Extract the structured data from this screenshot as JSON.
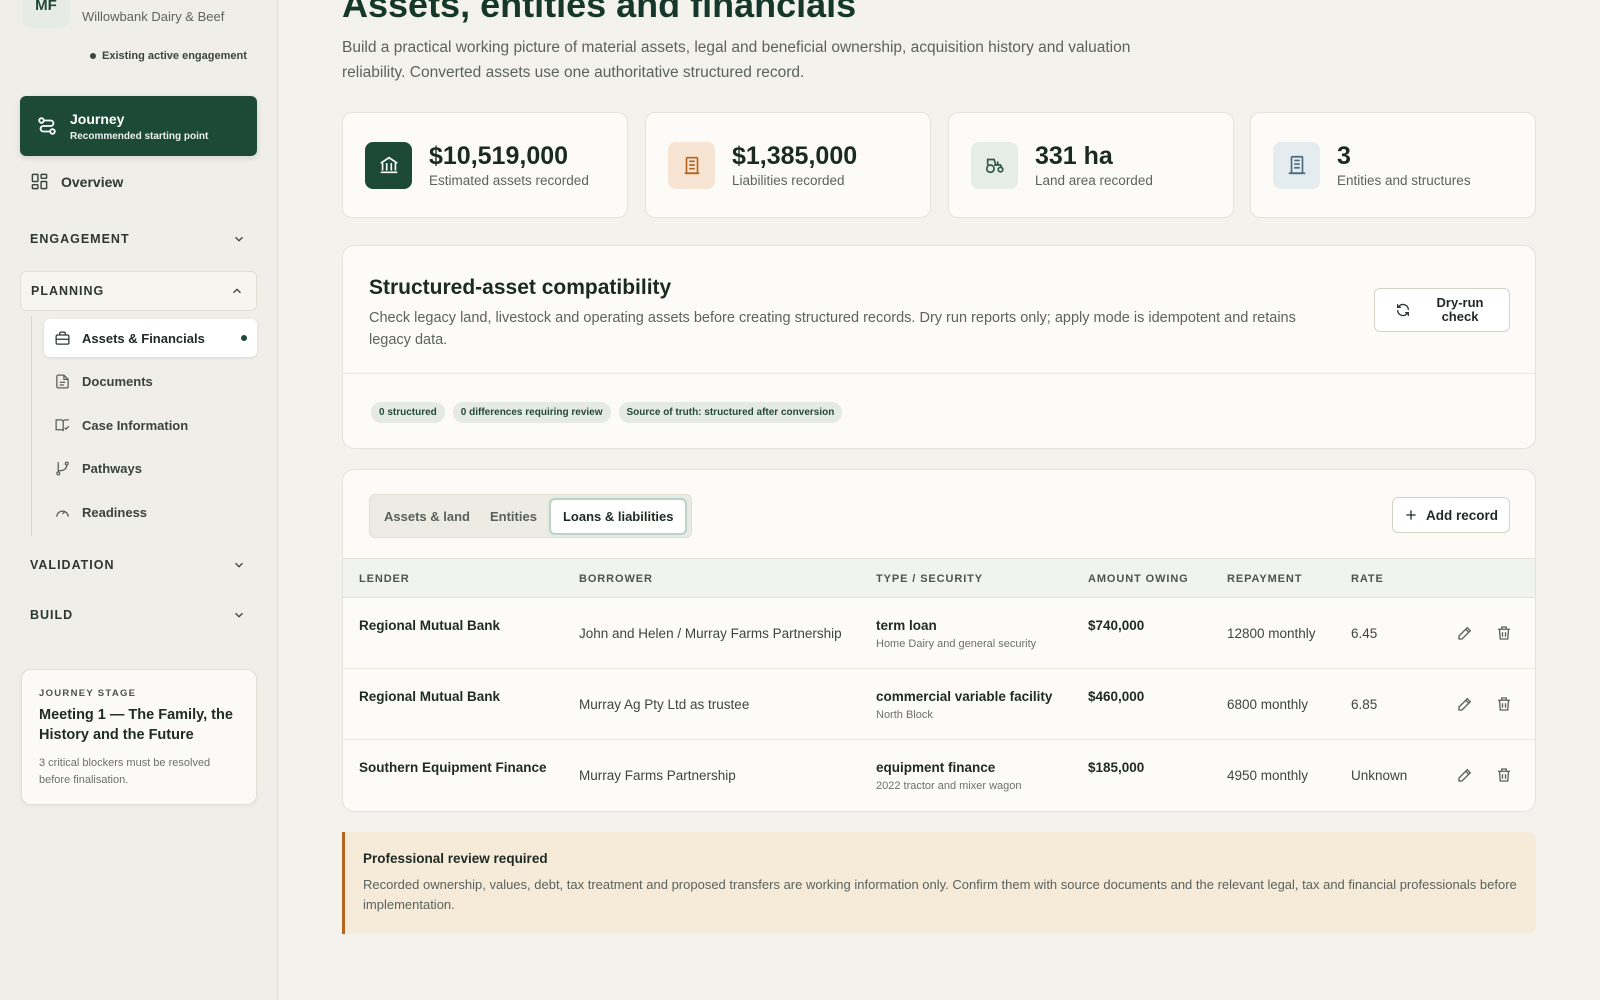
{
  "sidebar": {
    "client_initials": "MF",
    "client_subtitle": "Willowbank Dairy & Beef",
    "engagement_status": "Existing active engagement",
    "journey": {
      "title": "Journey",
      "subtitle": "Recommended starting point"
    },
    "overview": "Overview",
    "sections": {
      "engagement": "ENGAGEMENT",
      "planning": "PLANNING",
      "validation": "VALIDATION",
      "build": "BUILD"
    },
    "planning_items": [
      "Assets & Financials",
      "Documents",
      "Case Information",
      "Pathways",
      "Readiness"
    ],
    "active_item": "Assets & Financials",
    "stage": {
      "kicker": "JOURNEY STAGE",
      "title": "Meeting 1 — The Family, the History and the Future",
      "note": "3 critical blockers must be resolved before finalisation."
    }
  },
  "main": {
    "title": "Assets, entities and financials",
    "description": "Build a practical working picture of material assets, legal and beneficial ownership, acquisition history and valuation reliability. Converted assets use one authoritative structured record.",
    "stats": [
      {
        "icon": "bank-icon",
        "value": "$10,519,000",
        "label": "Estimated assets recorded",
        "bg": "#1d4a37",
        "fg": "#ffffff"
      },
      {
        "icon": "coins-icon",
        "value": "$1,385,000",
        "label": "Liabilities recorded",
        "bg": "#f7e4d2",
        "fg": "#b5651d"
      },
      {
        "icon": "tractor-icon",
        "value": "331 ha",
        "label": "Land area recorded",
        "bg": "#e6ece6",
        "fg": "#2d5a44"
      },
      {
        "icon": "building-icon",
        "value": "3",
        "label": "Entities and structures",
        "bg": "#e4ecf0",
        "fg": "#4a6c80"
      }
    ],
    "compat": {
      "title": "Structured-asset compatibility",
      "text": "Check legacy land, livestock and operating assets before creating structured records. Dry run reports only; apply mode is idempotent and retains legacy data.",
      "button": "Dry-run check",
      "chips": [
        "0 structured",
        "0 differences requiring review",
        "Source of truth: structured after conversion"
      ]
    },
    "tabs": [
      "Assets & land",
      "Entities",
      "Loans & liabilities"
    ],
    "active_tab": "Loans & liabilities",
    "add_button": "Add record",
    "columns": [
      "LENDER",
      "BORROWER",
      "TYPE / SECURITY",
      "AMOUNT OWING",
      "REPAYMENT",
      "RATE"
    ],
    "rows": [
      {
        "lender": "Regional Mutual Bank",
        "borrower": "John and Helen / Murray Farms Partnership",
        "type": "term loan",
        "security": "Home Dairy and general security",
        "amount": "$740,000",
        "repayment": "12800 monthly",
        "rate": "6.45"
      },
      {
        "lender": "Regional Mutual Bank",
        "borrower": "Murray Ag Pty Ltd as trustee",
        "type": "commercial variable facility",
        "security": "North Block",
        "amount": "$460,000",
        "repayment": "6800 monthly",
        "rate": "6.85"
      },
      {
        "lender": "Southern Equipment Finance",
        "borrower": "Murray Farms Partnership",
        "type": "equipment finance",
        "security": "2022 tractor and mixer wagon",
        "amount": "$185,000",
        "repayment": "4950 monthly",
        "rate": "Unknown"
      }
    ],
    "review": {
      "title": "Professional review required",
      "text": "Recorded ownership, values, debt, tax treatment and proposed transfers are working information only. Confirm them with source documents and the relevant legal, tax and financial professionals before implementation."
    }
  }
}
